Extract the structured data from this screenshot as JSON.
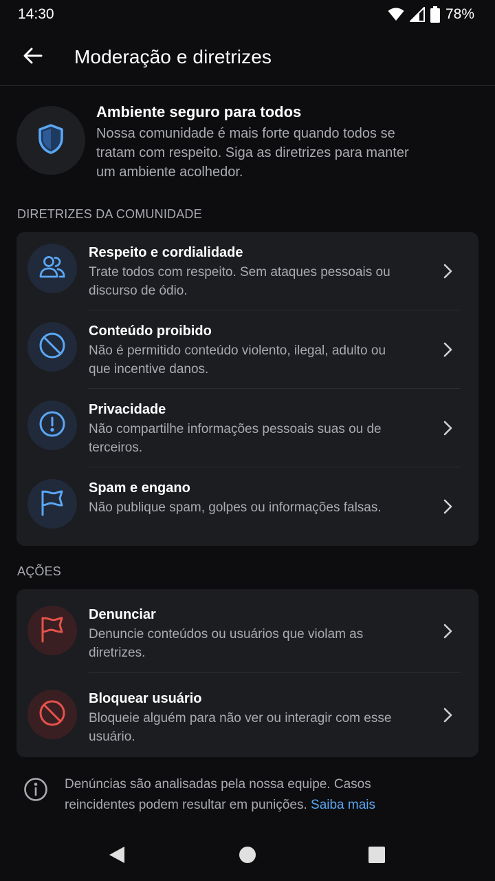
{
  "status_bar": {
    "time": "14:30",
    "battery": "78%",
    "icons": [
      "wifi-icon",
      "cell-signal-icon",
      "battery-icon"
    ]
  },
  "app_bar": {
    "back_icon": "arrow-left-icon",
    "title": "Moderação e diretrizes"
  },
  "intro": {
    "icon": "shield-icon",
    "title": "Ambiente seguro para todos",
    "description": "Nossa comunidade é mais forte quando todos se tratam com respeito. Siga as diretrizes para manter um ambiente acolhedor."
  },
  "guidelines": {
    "header": "DIRETRIZES DA COMUNIDADE",
    "items": [
      {
        "icon": "users-icon",
        "title": "Respeito e cordialidade",
        "description": "Trate todos com respeito. Sem ataques pessoais ou discurso de ódio."
      },
      {
        "icon": "prohibited-icon",
        "title": "Conteúdo proibido",
        "description": "Não é permitido conteúdo violento, ilegal, adulto ou que incentive danos."
      },
      {
        "icon": "alert-circle-icon",
        "title": "Privacidade",
        "description": "Não compartilhe informações pessoais suas ou de terceiros."
      },
      {
        "icon": "flag-icon",
        "title": "Spam e engano",
        "description": "Não publique spam, golpes ou informações falsas."
      }
    ]
  },
  "actions": {
    "header": "AÇÕES",
    "items": [
      {
        "icon": "flag-icon",
        "title": "Denunciar",
        "description": "Denuncie conteúdos ou usuários que violam as diretrizes."
      },
      {
        "icon": "block-icon",
        "title": "Bloquear usuário",
        "description": "Bloqueie alguém para não ver ou interagir com esse usuário."
      }
    ]
  },
  "footer": {
    "icon": "info-icon",
    "text": "Denúncias são analisadas pela nossa equipe. Casos reincidentes podem resultar em punições.",
    "link": "Saiba mais"
  },
  "nav_bar": {
    "icons": [
      "nav-back-icon",
      "nav-home-icon",
      "nav-recents-icon"
    ]
  },
  "colors": {
    "background": "#0d0d0f",
    "card": "#1c1d21",
    "accent_blue": "#5ba7f5",
    "accent_red": "#e5534b",
    "text_secondary": "#a9abb1"
  }
}
